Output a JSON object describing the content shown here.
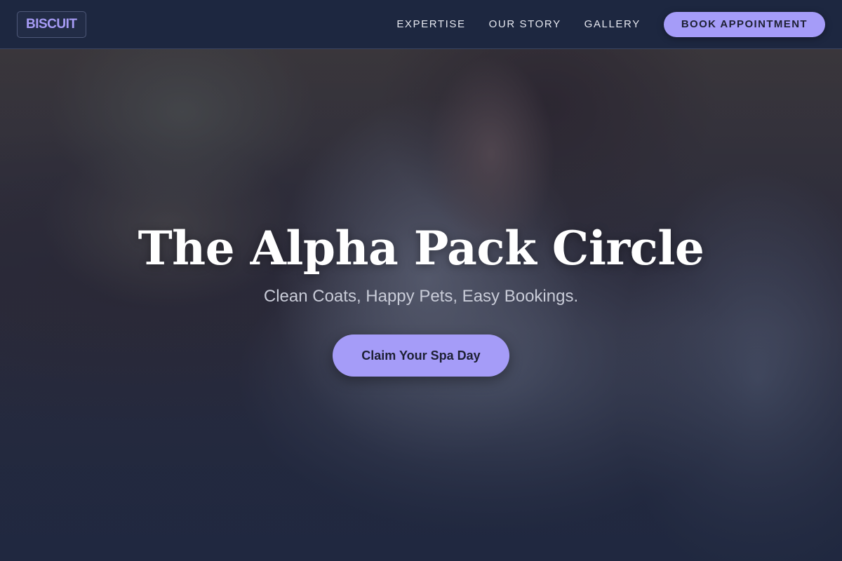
{
  "brand": {
    "logo_text": "BISCUIT",
    "accent_color": "#a59cf8",
    "nav_bg_color": "#1d2740"
  },
  "nav": {
    "links": [
      "EXPERTISE",
      "OUR STORY",
      "GALLERY"
    ],
    "cta_label": "BOOK APPOINTMENT"
  },
  "hero": {
    "background_image": "photo of a woman hugging a white rabbit",
    "title": "The Alpha Pack Circle",
    "subtitle": "Clean Coats, Happy Pets, Easy Bookings.",
    "cta_label": "Claim Your Spa Day"
  }
}
